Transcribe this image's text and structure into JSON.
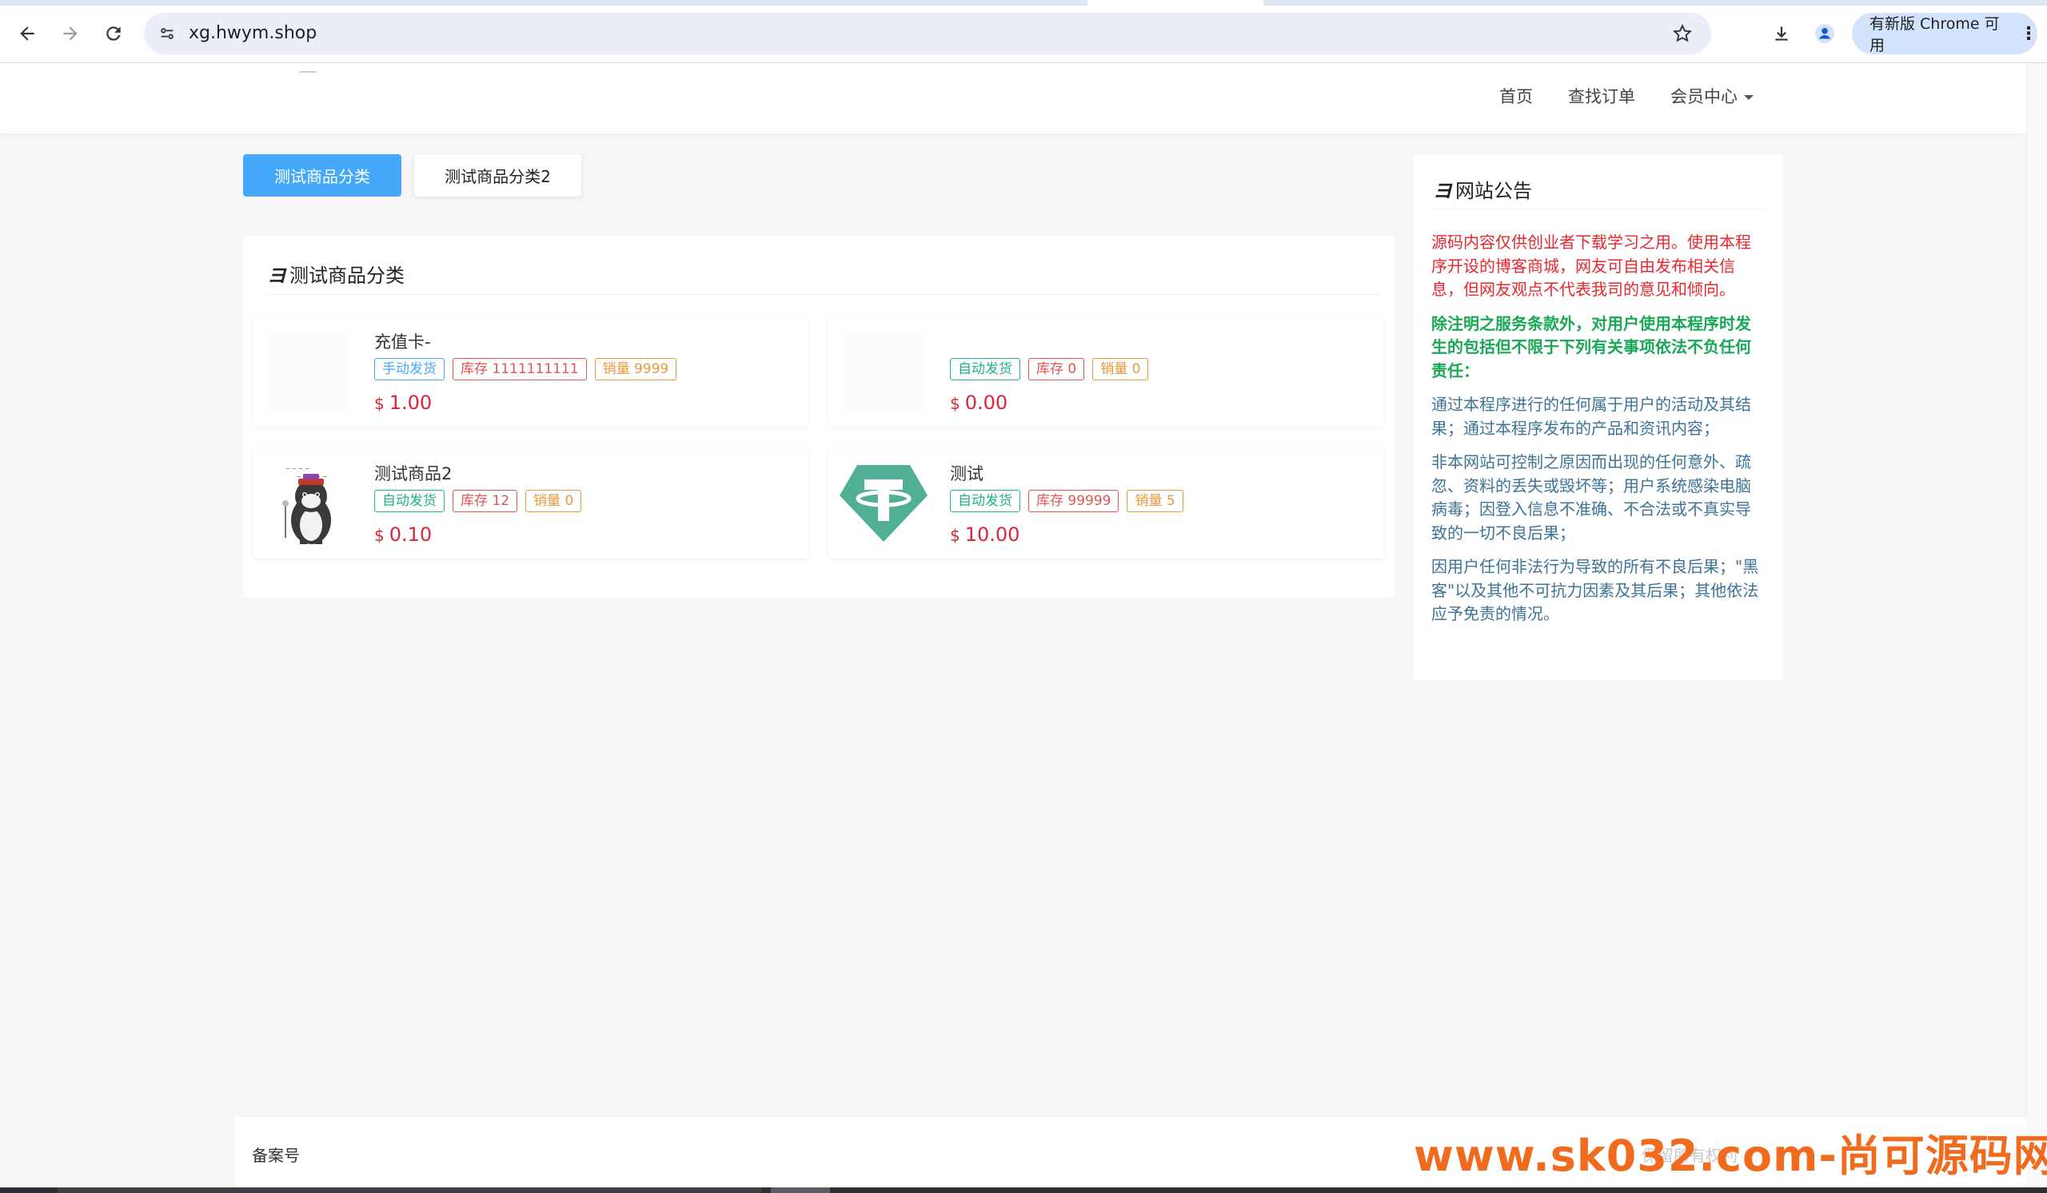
{
  "browser": {
    "url": "xg.hwym.shop",
    "update_button": "有新版 Chrome 可用"
  },
  "site_nav": {
    "home": "首页",
    "find_order": "查找订单",
    "member_center": "会员中心"
  },
  "category_tabs": [
    "测试商品分类",
    "测试商品分类2"
  ],
  "main_panel": {
    "title": "测试商品分类",
    "products": [
      {
        "name": "充值卡-",
        "delivery": "手动发货",
        "stock": "库存 1111111111",
        "sales": "销量 9999",
        "currency": "$",
        "price": "1.00",
        "thumb": "blank-image"
      },
      {
        "name": "",
        "delivery": "自动发货",
        "stock": "库存 0",
        "sales": "销量 0",
        "currency": "$",
        "price": "0.00",
        "thumb": "blank-image"
      },
      {
        "name": "测试商品2",
        "delivery": "自动发货",
        "stock": "库存 12",
        "sales": "销量 0",
        "currency": "$",
        "price": "0.10",
        "thumb": "cat-cartoon-image"
      },
      {
        "name": "测试",
        "delivery": "自动发货",
        "stock": "库存 99999",
        "sales": "销量 5",
        "currency": "$",
        "price": "10.00",
        "thumb": "tether-logo"
      }
    ]
  },
  "notice": {
    "title": "网站公告",
    "p1": "源码内容仅供创业者下载学习之用。使用本程序开设的博客商城，网友可自由发布相关信息，但网友观点不代表我司的意见和倾向。",
    "p2": "除注明之服务条款外，对用户使用本程序时发生的包括但不限于下列有关事项依法不负任何责任：",
    "p3": "通过本程序进行的任何属于用户的活动及其结果；通过本程序发布的产品和资讯内容；",
    "p4": "非本网站可控制之原因而出现的任何意外、疏忽、资料的丢失或毁坏等；用户系统感染电脑病毒；因登入信息不准确、不合法或不真实导致的一切不良后果；",
    "p5": "因用户任何非法行为导致的所有不良后果；\"黑客\"以及其他不可抗力因素及其后果；其他依法应予免责的情况。"
  },
  "footer": {
    "beian": "备案号",
    "rights": "保留所有权利"
  },
  "watermark": "www.sk032.com-尚可源码网",
  "colors": {
    "primary": "#46a8fa",
    "price": "#d9263c",
    "auto_badge": "#1fb28c",
    "stock_badge": "#e35454",
    "sales_badge": "#e6983b",
    "notice_red": "#e8262e",
    "notice_green": "#18a855",
    "notice_blue": "#3c7397",
    "watermark": "#f16b1e"
  }
}
